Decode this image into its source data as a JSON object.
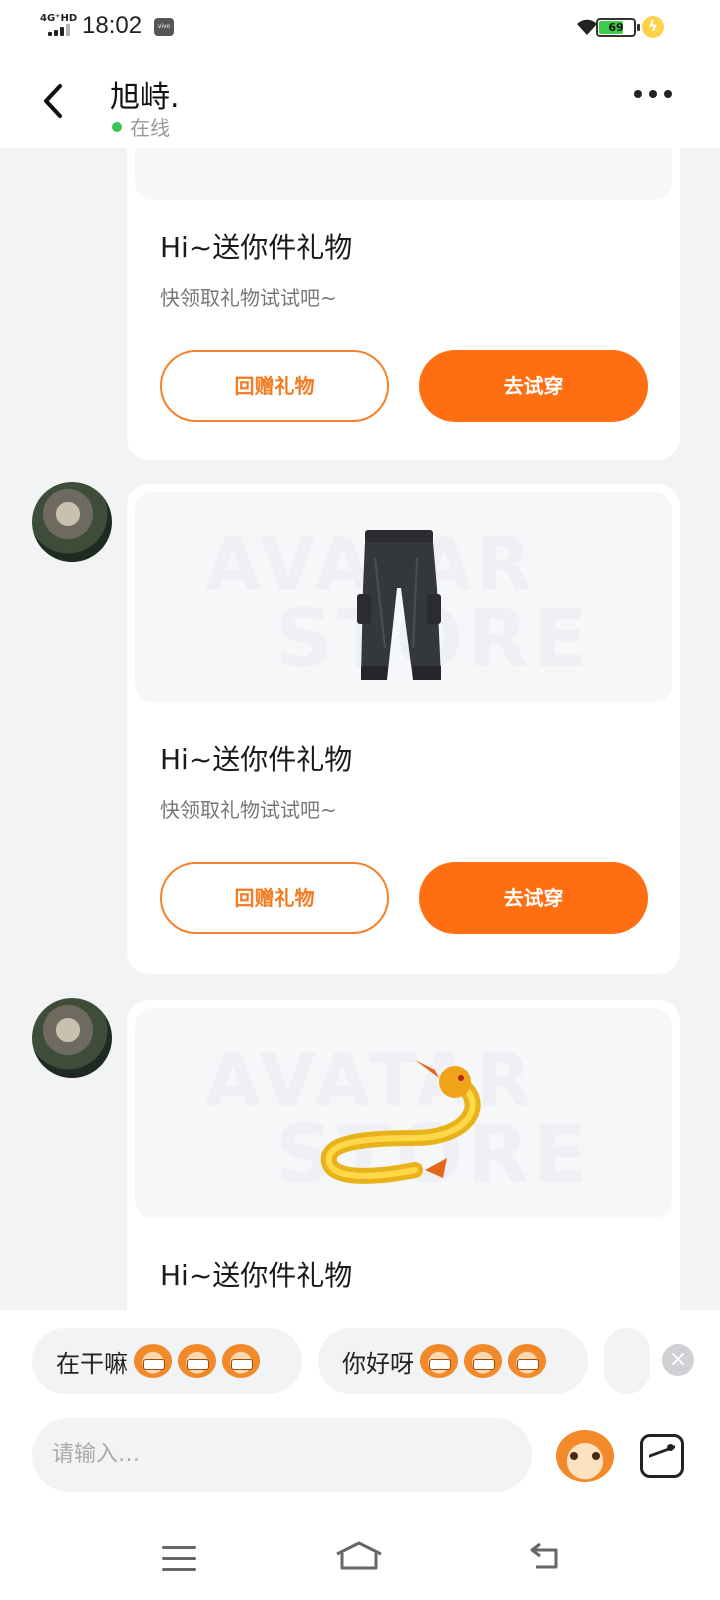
{
  "status_bar": {
    "network": "4G⁺HD",
    "time": "18:02",
    "carrier_badge": "vivo",
    "battery": "69",
    "icons": [
      "signal-icon",
      "wifi-icon",
      "battery-icon",
      "charging-icon"
    ]
  },
  "header": {
    "back_icon": "chevron-left-icon",
    "contact_name": "旭峙.",
    "presence": "在线",
    "presence_color": "#35c759",
    "more_icon": "more-dots-icon"
  },
  "messages": [
    {
      "title": "Hi~送你件礼物",
      "subtitle": "快领取礼物试试吧~",
      "return_gift": "回赠礼物",
      "try_on": "去试穿",
      "item": ""
    },
    {
      "title": "Hi~送你件礼物",
      "subtitle": "快领取礼物试试吧~",
      "return_gift": "回赠礼物",
      "try_on": "去试穿",
      "item": "black-cargo-pants-image"
    },
    {
      "title": "Hi~送你件礼物",
      "item": "golden-dragon-image"
    }
  ],
  "watermark": {
    "line1": "AVATAR",
    "line2": "STORE"
  },
  "quick_replies": [
    {
      "text": "在干嘛"
    },
    {
      "text": "你好呀"
    }
  ],
  "composer": {
    "placeholder": "请输入…"
  },
  "colors": {
    "accent": "#ff6f12",
    "accent_outline": "#f7802a",
    "background": "#f2f3f5"
  }
}
